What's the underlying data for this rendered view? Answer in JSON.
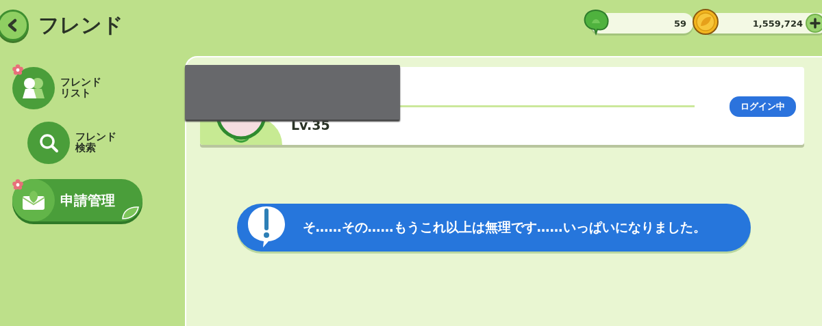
{
  "header": {
    "title": "フレンド"
  },
  "currencies": [
    {
      "kind": "leaf",
      "amount": "59",
      "addable": false
    },
    {
      "kind": "coin",
      "amount": "1,559,724",
      "addable": true
    }
  ],
  "sidebar": {
    "items": [
      {
        "kind": "friends",
        "label": "フレンドリスト",
        "selected": false,
        "badge": true
      },
      {
        "kind": "search",
        "label": "フレンド検索",
        "selected": false,
        "badge": false
      },
      {
        "kind": "requests",
        "label": "申請管理",
        "selected": true,
        "badge": true
      }
    ]
  },
  "friend_card": {
    "level": "Lv.35",
    "status": "ログイン中"
  },
  "toast": {
    "message": "そ……その……もうこれ以上は無理です……いっぱいになりました。"
  }
}
